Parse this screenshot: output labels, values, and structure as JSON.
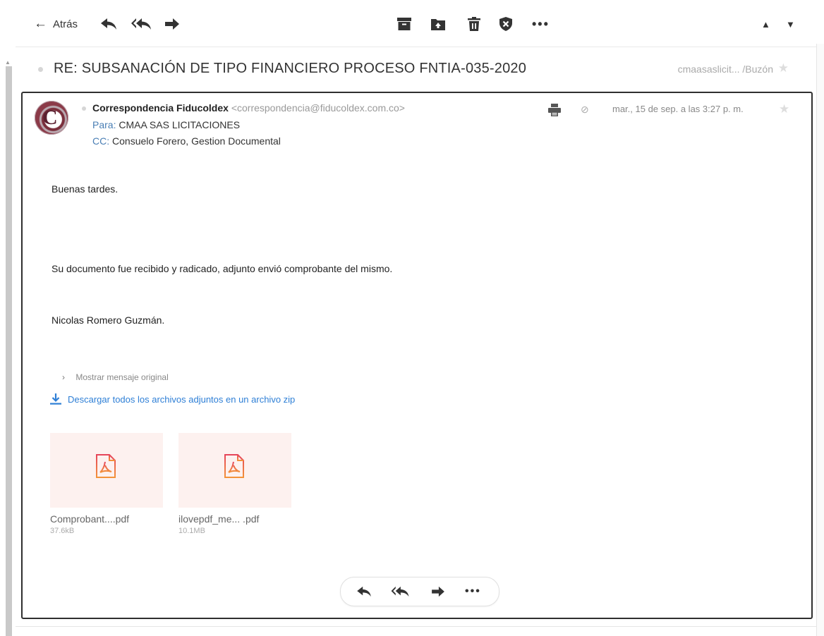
{
  "toolbar": {
    "back_label": "Atrás",
    "back_arrow": "←",
    "icons": [
      "reply-icon",
      "reply-all-icon",
      "forward-icon",
      "archive-icon",
      "move-to-folder-icon",
      "delete-icon",
      "block-sender-icon",
      "more-icon",
      "previous-message-icon",
      "next-message-icon"
    ],
    "more_glyph": "•••",
    "prev_glyph": "▲",
    "next_glyph": "▼"
  },
  "subject": {
    "text": "RE: SUBSANACIÓN DE TIPO FINANCIERO PROCESO FNTIA-035-2020",
    "folder": "cmaasaslicit... /Buzón",
    "star": "★"
  },
  "message": {
    "avatar_letter": "C",
    "sender_name": "Correspondencia Fiducoldex",
    "sender_email": "<correspondencia@fiducoldex.com.co>",
    "to_label": "Para:",
    "to_value": "CMAA SAS LICITACIONES",
    "cc_label": "CC:",
    "cc_value": "Consuelo Forero,  Gestion Documental",
    "date": "mar., 15 de sep. a las 3:27 p. m.",
    "star": "★",
    "clip_glyph": "⊘"
  },
  "body": {
    "greeting": "Buenas tardes.",
    "line1": "Su documento fue recibido y radicado, adjunto envió comprobante del mismo.",
    "signature": "Nicolas Romero Guzmán."
  },
  "show_original": {
    "chevron": "›",
    "label": "Mostrar mensaje original"
  },
  "download_all": {
    "label": "Descargar todos los archivos adjuntos en un archivo zip"
  },
  "attachments": [
    {
      "name": "Comprobant....pdf",
      "size": "37.6kB",
      "icon": "pdf-icon"
    },
    {
      "name": "ilovepdf_me... .pdf",
      "size": "10.1MB",
      "icon": "pdf-icon"
    }
  ],
  "bottom_actions": {
    "more_glyph": "•••"
  },
  "colors": {
    "link": "#2e7fd6",
    "label_blue": "#4a7fb5",
    "pdf_red": "#e6455b",
    "pdf_orange": "#f3933a",
    "attachment_bg": "#fdf1ef"
  }
}
